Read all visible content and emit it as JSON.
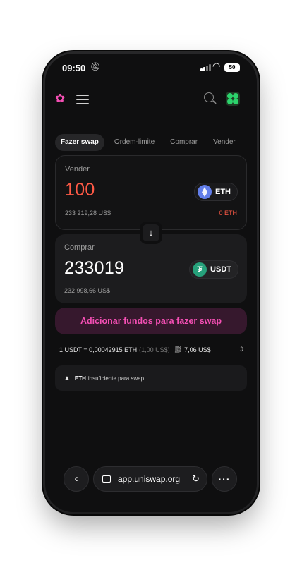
{
  "status_bar": {
    "time": "09:50",
    "battery": "50"
  },
  "nav": {
    "logo_icon": "uniswap-unicorn-icon",
    "menu_icon": "hamburger-icon",
    "search_icon": "search-icon",
    "avatar_icon": "account-avatar-icon"
  },
  "tabs": [
    {
      "label": "Fazer swap",
      "active": true
    },
    {
      "label": "Ordem-limite",
      "active": false
    },
    {
      "label": "Comprar",
      "active": false
    },
    {
      "label": "Vender",
      "active": false
    }
  ],
  "sell": {
    "label": "Vender",
    "amount": "100",
    "usd_value": "233 219,28 US$",
    "token": "ETH",
    "balance": "0 ETH"
  },
  "buy": {
    "label": "Comprar",
    "amount": "233019",
    "usd_value": "232 998,66 US$",
    "token": "USDT",
    "token_glyph": "₮"
  },
  "switch_icon": "↓",
  "cta": {
    "label": "Adicionar fundos para fazer swap"
  },
  "rate": {
    "text": "1 USDT = 0,00042915 ETH",
    "usd": "(1,00 US$)",
    "gas": "7,06 US$"
  },
  "warning": {
    "token": "ETH",
    "text": "insuficiente para swap"
  },
  "browser": {
    "url": "app.uniswap.org"
  },
  "colors": {
    "accent": "#f44fb4",
    "error": "#ff5a46",
    "background": "#0f0f10"
  }
}
